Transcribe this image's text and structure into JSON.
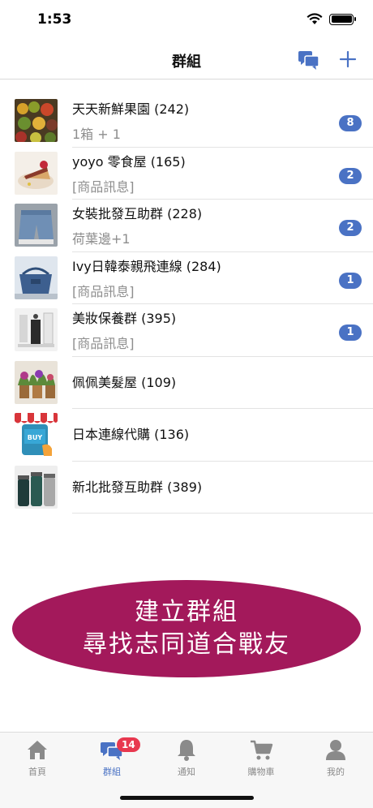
{
  "status_bar": {
    "time": "1:53"
  },
  "nav": {
    "title": "群組"
  },
  "groups": [
    {
      "title": "天天新鮮果園 (242)",
      "subtitle": "1箱 + 1",
      "badge": "8"
    },
    {
      "title": "yoyo 零食屋 (165)",
      "subtitle": "[商品訊息]",
      "badge": "2"
    },
    {
      "title": "女裝批發互助群 (228)",
      "subtitle": "荷葉邊+1",
      "badge": "2"
    },
    {
      "title": "Ivy日韓泰親飛連線 (284)",
      "subtitle": "[商品訊息]",
      "badge": "1"
    },
    {
      "title": "美妝保養群 (395)",
      "subtitle": "[商品訊息]",
      "badge": "1"
    },
    {
      "title": "佩佩美髮屋 (109)"
    },
    {
      "title": "日本連線代購 (136)",
      "thumb_text": "BUY"
    },
    {
      "title": "新北批發互助群 (389)"
    }
  ],
  "promo": {
    "line1": "建立群組",
    "line2": "尋找志同道合戰友"
  },
  "tabs": [
    {
      "label": "首頁",
      "icon": "home-icon"
    },
    {
      "label": "群組",
      "icon": "chat-icon",
      "badge": "14",
      "active": true
    },
    {
      "label": "通知",
      "icon": "bell-icon"
    },
    {
      "label": "購物車",
      "icon": "cart-icon"
    },
    {
      "label": "我的",
      "icon": "person-icon"
    }
  ],
  "colors": {
    "accent": "#4a72c4",
    "promo": "#a3195b",
    "tab_badge": "#e8384f",
    "inactive": "#8a8a8a"
  }
}
